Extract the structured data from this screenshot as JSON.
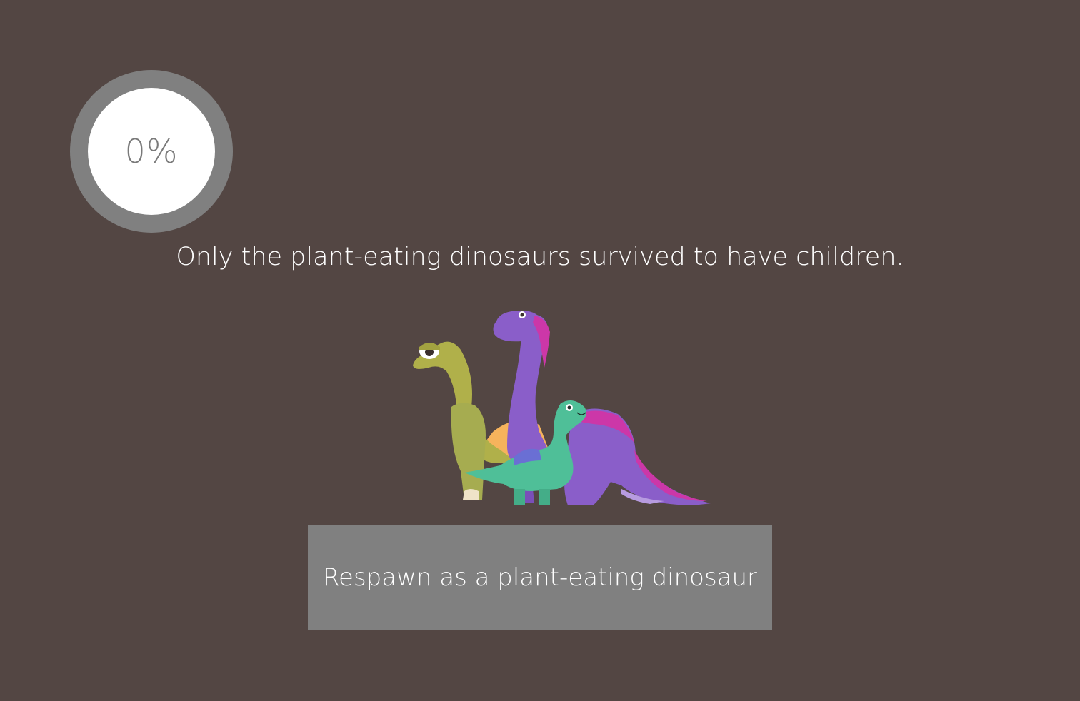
{
  "progress": {
    "value_percent": 0,
    "label": "0%",
    "ring_color": "#808080",
    "inner_color": "#ffffff"
  },
  "message": "Only the plant-eating dinosaurs survived to have children.",
  "illustration": {
    "icon": "plant-eating-dinosaurs-illustration"
  },
  "respawn_button": {
    "label": "Respawn as a plant-eating dinosaur",
    "color": "#808080"
  },
  "colors": {
    "background": "#534643",
    "text": "#ffffff"
  }
}
